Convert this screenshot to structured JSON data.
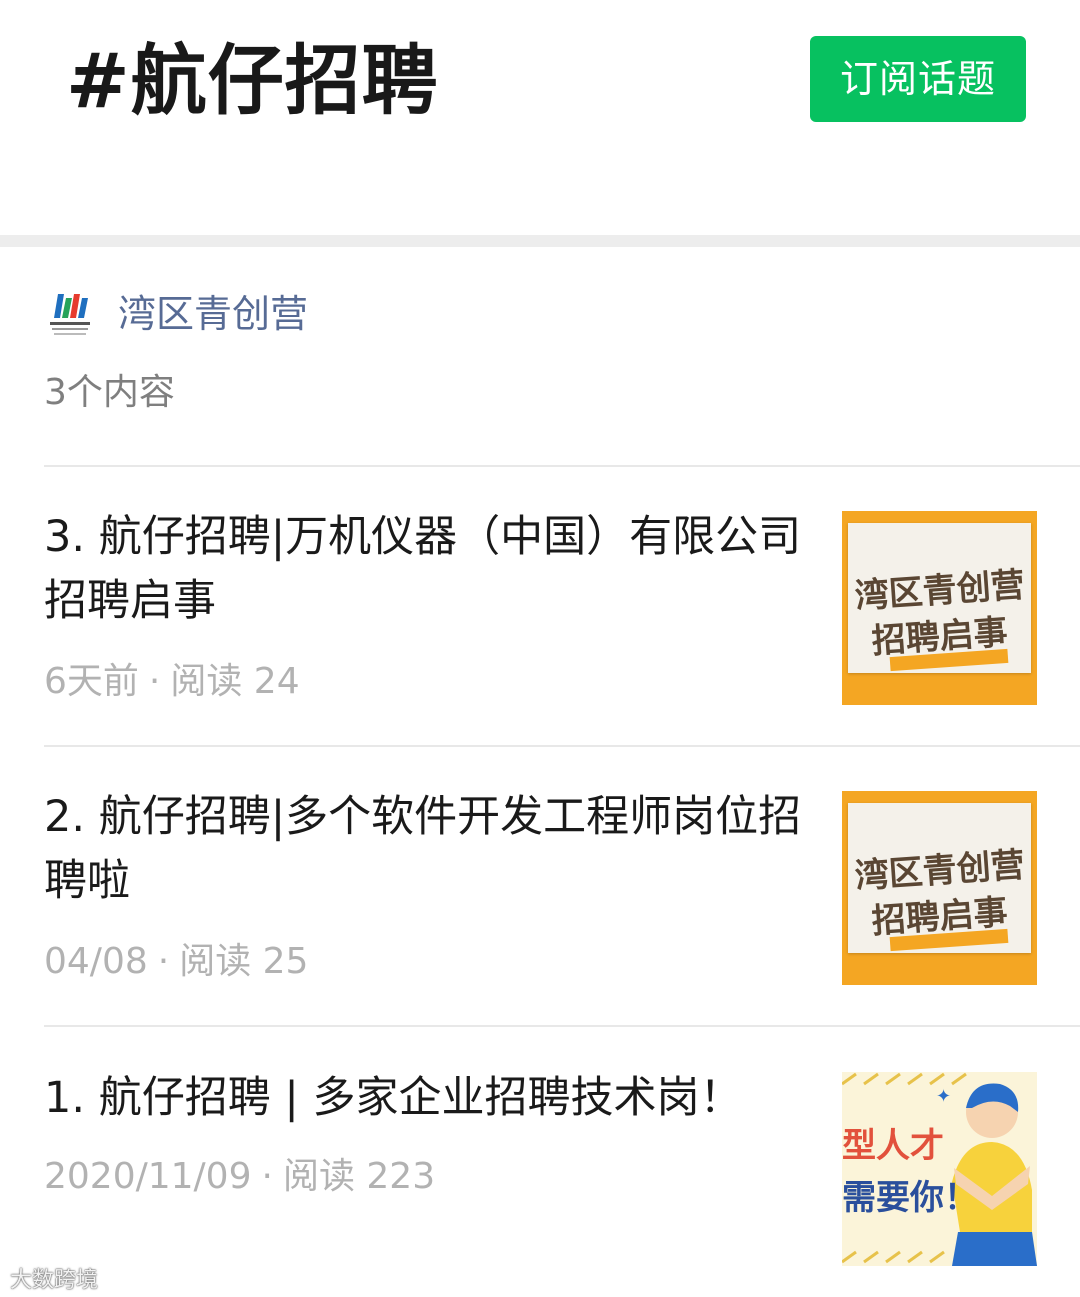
{
  "header": {
    "topic_title": "#航仔招聘",
    "subscribe_label": "订阅话题"
  },
  "account": {
    "name": "湾区青创营",
    "content_count": "3个内容"
  },
  "articles": [
    {
      "title": "3. 航仔招聘|万机仪器（中国）有限公司招聘启事",
      "time": "6天前",
      "reads": "阅读 24",
      "thumb_line1": "湾区青创营",
      "thumb_line2": "招聘启事"
    },
    {
      "title": "2. 航仔招聘|多个软件开发工程师岗位招聘啦",
      "time": "04/08",
      "reads": "阅读 25",
      "thumb_line1": "湾区青创营",
      "thumb_line2": "招聘启事"
    },
    {
      "title": "1. 航仔招聘 | 多家企业招聘技术岗！",
      "time": "2020/11/09",
      "reads": "阅读 223",
      "thumb_line1": "型人才",
      "thumb_line2": "需要你！"
    }
  ],
  "meta_separator": "·",
  "watermark": "大数跨境",
  "colors": {
    "subscribe_button": "#07c160",
    "account_link": "#576b95",
    "thumb_orange": "#f4a623"
  }
}
